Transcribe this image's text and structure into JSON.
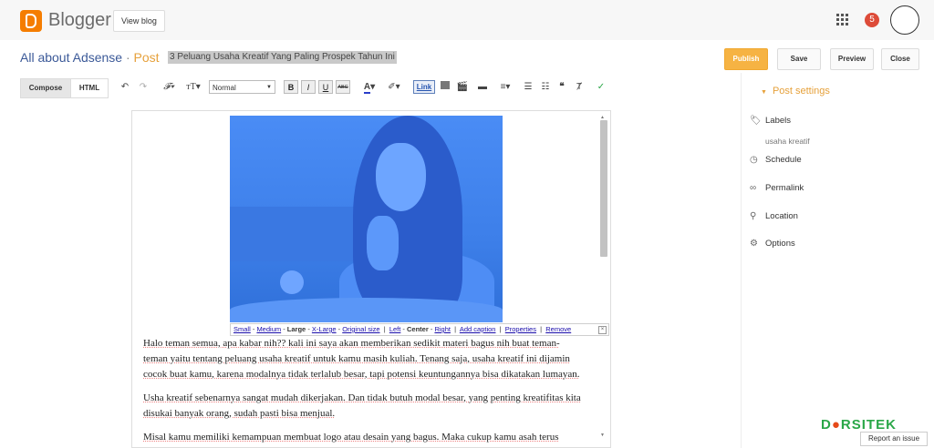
{
  "topbar": {
    "brand": "Blogger",
    "view_blog": "View blog",
    "notification_count": "5",
    "icons": [
      "blogger-logo",
      "apps-grid-icon",
      "notification-badge",
      "avatar"
    ]
  },
  "header": {
    "blog_name": "All about Adsense",
    "separator": "·",
    "crumb": "Post",
    "post_title": "3 Peluang Usaha Kreatif Yang Paling Prospek Tahun Ini",
    "actions": {
      "publish": "Publish",
      "save": "Save",
      "preview": "Preview",
      "close": "Close"
    }
  },
  "toolbar": {
    "compose": "Compose",
    "html": "HTML",
    "font_style": "Normal",
    "bold": "B",
    "italic": "I",
    "underline": "U",
    "strike": "ABC",
    "link": "Link"
  },
  "image_bar": {
    "small": "Small",
    "medium": "Medium",
    "large": "Large",
    "xlarge": "X-Large",
    "original": "Original size",
    "left": "Left",
    "center": "Center",
    "right": "Right",
    "add_caption": "Add caption",
    "properties": "Properties",
    "remove": "Remove"
  },
  "content": {
    "p1_l1": "Halo teman semua, apa kabar nih?? kali ini saya akan memberikan sedikit materi bagus nih buat teman-",
    "p1_l2": "teman yaitu tentang peluang usaha kreatif untuk kamu masih kuliah. Tenang saja, usaha kreatif ini dijamin",
    "p1_l3": "cocok buat kamu, karena modalnya tidak terlalub besar, tapi potensi keuntungannya bisa dikatakan lumayan.",
    "p2_l1": "Usha kreatif sebenarnya sangat mudah dikerjakan. Dan tidak butuh modal besar, yang penting kreatifitas kita",
    "p2_l2": "disukai banyak orang, sudah pasti bisa menjual.",
    "p3_l1": "Misal kamu memiliki kemampuan membuat logo atau desain yang bagus. Maka cukup kamu asah terus"
  },
  "sidebar": {
    "heading": "Post settings",
    "labels": "Labels",
    "labels_value": "usaha kreatif",
    "schedule": "Schedule",
    "permalink": "Permalink",
    "location": "Location",
    "options": "Options"
  },
  "watermark": {
    "text_a": "D",
    "text_b": "RSITEK",
    "report": "Report an issue"
  }
}
